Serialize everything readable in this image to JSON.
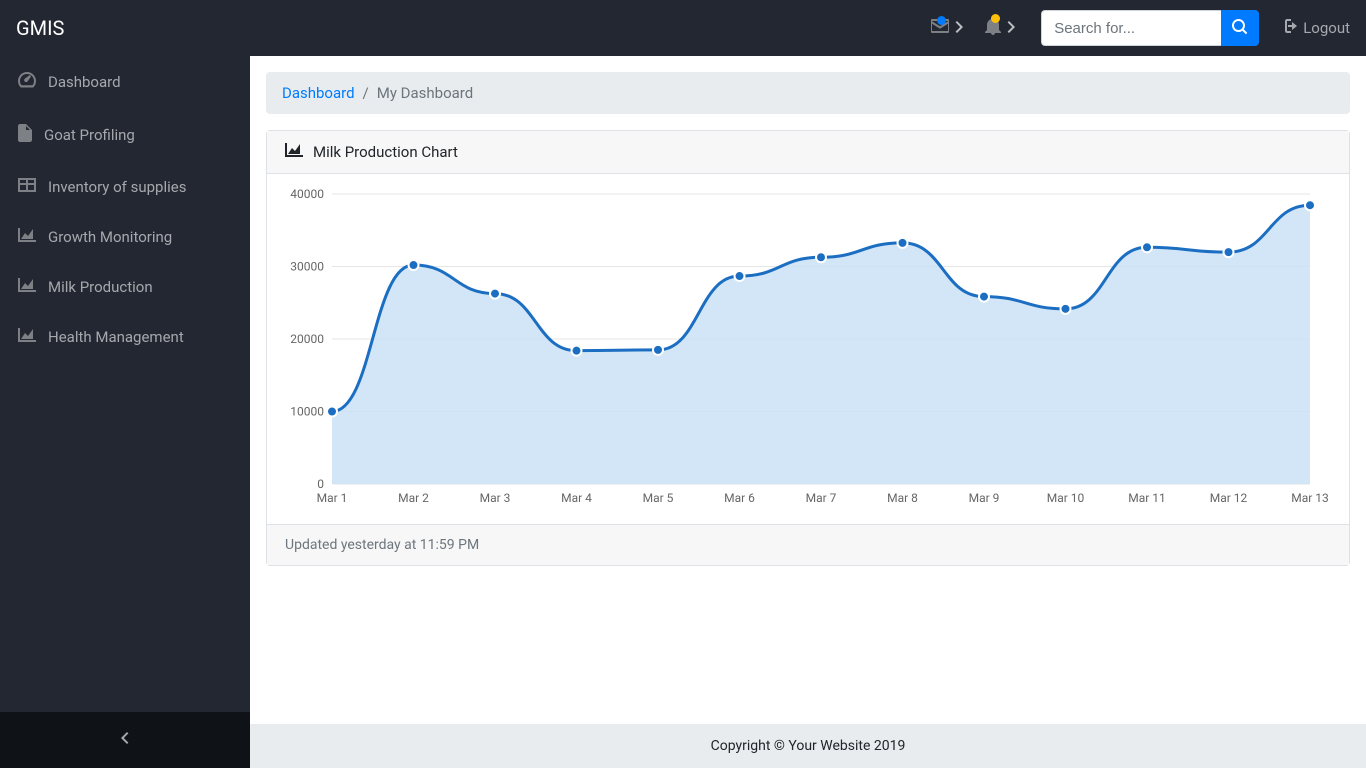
{
  "brand": "GMIS",
  "navbar": {
    "search_placeholder": "Search for...",
    "logout": "Logout"
  },
  "sidebar": {
    "items": [
      {
        "label": "Dashboard",
        "icon": "tachometer"
      },
      {
        "label": "Goat Profiling",
        "icon": "file"
      },
      {
        "label": "Inventory of supplies",
        "icon": "table"
      },
      {
        "label": "Growth Monitoring",
        "icon": "area-chart"
      },
      {
        "label": "Milk Production",
        "icon": "area-chart"
      },
      {
        "label": "Health Management",
        "icon": "area-chart"
      }
    ]
  },
  "breadcrumb": {
    "root": "Dashboard",
    "current": "My Dashboard"
  },
  "card": {
    "title": "Milk Production Chart",
    "footer": "Updated yesterday at 11:59 PM"
  },
  "footer": "Copyright © Your Website 2019",
  "chart_data": {
    "type": "area",
    "title": "Milk Production Chart",
    "xlabel": "",
    "ylabel": "",
    "categories": [
      "Mar 1",
      "Mar 2",
      "Mar 3",
      "Mar 4",
      "Mar 5",
      "Mar 6",
      "Mar 7",
      "Mar 8",
      "Mar 9",
      "Mar 10",
      "Mar 11",
      "Mar 12",
      "Mar 13"
    ],
    "values": [
      10000,
      30200,
      26263,
      18394,
      18500,
      28682,
      31274,
      33259,
      25849,
      24159,
      32651,
      31984,
      38451
    ],
    "ylim": [
      0,
      40000
    ],
    "yticks": [
      0,
      10000,
      20000,
      30000,
      40000
    ],
    "line_color": "#1b6ec2",
    "fill_color": "#cbe2f6",
    "point_color": "#1b6ec2",
    "grid": true
  }
}
